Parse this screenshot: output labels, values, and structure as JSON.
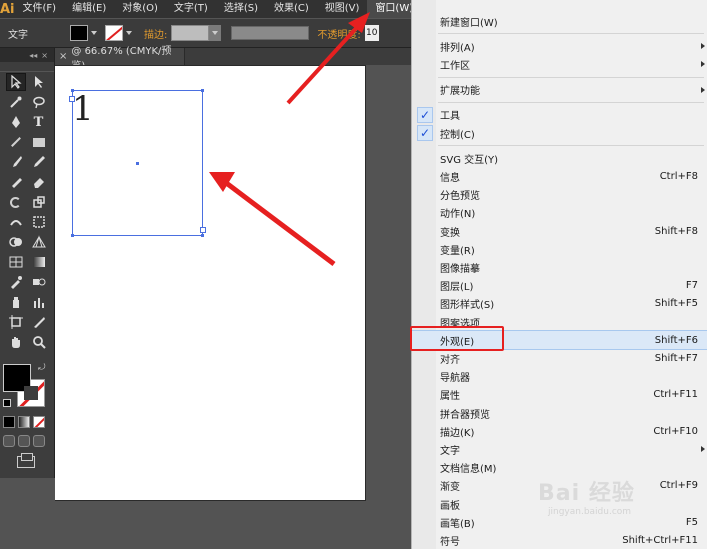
{
  "app": {
    "logo": "Ai"
  },
  "menubar": {
    "items": [
      {
        "label": "文件(F)",
        "name": "menu-file"
      },
      {
        "label": "编辑(E)",
        "name": "menu-edit"
      },
      {
        "label": "对象(O)",
        "name": "menu-object"
      },
      {
        "label": "文字(T)",
        "name": "menu-type"
      },
      {
        "label": "选择(S)",
        "name": "menu-select"
      },
      {
        "label": "效果(C)",
        "name": "menu-effect"
      },
      {
        "label": "视图(V)",
        "name": "menu-view"
      },
      {
        "label": "窗口(W)",
        "name": "menu-window"
      }
    ]
  },
  "controlbar": {
    "mode_label": "文字",
    "stroke_label": "描边:",
    "opacity_label": "不透明度:",
    "opacity_value": "10"
  },
  "document": {
    "tab_title": "@ 66.67% (CMYK/预览)",
    "tab_close": "×",
    "text_content": "1"
  },
  "tools": {
    "header_collapse": "◂◂",
    "header_close": "×"
  },
  "window_menu": {
    "groups": [
      [
        {
          "label": "新建窗口(W)"
        }
      ],
      [
        {
          "label": "排列(A)",
          "submenu": true
        },
        {
          "label": "工作区",
          "submenu": true
        }
      ],
      [
        {
          "label": "扩展功能",
          "submenu": true
        }
      ],
      [
        {
          "label": "工具",
          "checked": true
        },
        {
          "label": "控制(C)",
          "checked": true
        }
      ],
      [
        {
          "label": "SVG 交互(Y)"
        },
        {
          "label": "信息",
          "shortcut": "Ctrl+F8"
        },
        {
          "label": "分色预览"
        },
        {
          "label": "动作(N)"
        },
        {
          "label": "变换",
          "shortcut": "Shift+F8"
        },
        {
          "label": "变量(R)"
        },
        {
          "label": "图像描摹"
        },
        {
          "label": "图层(L)",
          "shortcut": "F7"
        },
        {
          "label": "图形样式(S)",
          "shortcut": "Shift+F5"
        },
        {
          "label": "图案选项"
        },
        {
          "label": "外观(E)",
          "shortcut": "Shift+F6",
          "highlighted": true
        },
        {
          "label": "对齐",
          "shortcut": "Shift+F7"
        },
        {
          "label": "导航器"
        },
        {
          "label": "属性",
          "shortcut": "Ctrl+F11"
        },
        {
          "label": "拼合器预览"
        },
        {
          "label": "描边(K)",
          "shortcut": "Ctrl+F10"
        },
        {
          "label": "文字",
          "submenu": true
        },
        {
          "label": "文档信息(M)"
        },
        {
          "label": "渐变",
          "shortcut": "Ctrl+F9"
        },
        {
          "label": "画板"
        },
        {
          "label": "画笔(B)",
          "shortcut": "F5"
        },
        {
          "label": "符号",
          "shortcut": "Shift+Ctrl+F11"
        }
      ]
    ]
  },
  "watermark": {
    "main": "Bai 经验",
    "sub": "jingyan.baidu.com"
  },
  "colors": {
    "annotation_red": "#e62020",
    "selection_blue": "#4a6fe0",
    "menu_highlight": "#dbe8f7",
    "ui_dark": "#323232"
  }
}
